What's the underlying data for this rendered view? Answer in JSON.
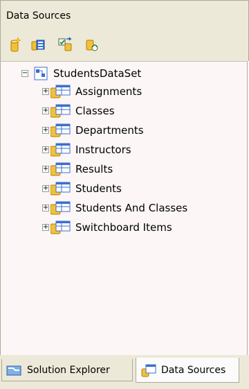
{
  "window": {
    "title": "Data Sources"
  },
  "toolbar": {
    "buttons": [
      {
        "name": "add-new-data-source",
        "icon": "database-add-icon"
      },
      {
        "name": "edit-dataset-designer",
        "icon": "dataset-designer-icon"
      },
      {
        "name": "configure-dataset-wizard",
        "icon": "configure-dataset-icon"
      },
      {
        "name": "refresh",
        "icon": "refresh-icon"
      }
    ]
  },
  "tree": {
    "root": {
      "label": "StudentsDataSet",
      "expanded": true,
      "icon": "dataset-icon"
    },
    "items": [
      {
        "label": "Assignments",
        "icon": "table-icon",
        "expanded": false
      },
      {
        "label": "Classes",
        "icon": "table-icon",
        "expanded": false
      },
      {
        "label": "Departments",
        "icon": "table-icon",
        "expanded": false
      },
      {
        "label": "Instructors",
        "icon": "table-icon",
        "expanded": false
      },
      {
        "label": "Results",
        "icon": "table-icon",
        "expanded": false
      },
      {
        "label": "Students",
        "icon": "table-icon",
        "expanded": false
      },
      {
        "label": "Students And Classes",
        "icon": "table-icon",
        "expanded": false
      },
      {
        "label": "Switchboard Items",
        "icon": "table-icon",
        "expanded": false
      }
    ]
  },
  "tabs": [
    {
      "label": "Solution Explorer",
      "active": false,
      "icon": "solution-explorer-icon"
    },
    {
      "label": "Data Sources",
      "active": true,
      "icon": "data-sources-icon"
    }
  ],
  "colors": {
    "chrome": "#ece9d8",
    "panel": "#fcf6f6",
    "border": "#aca899"
  }
}
